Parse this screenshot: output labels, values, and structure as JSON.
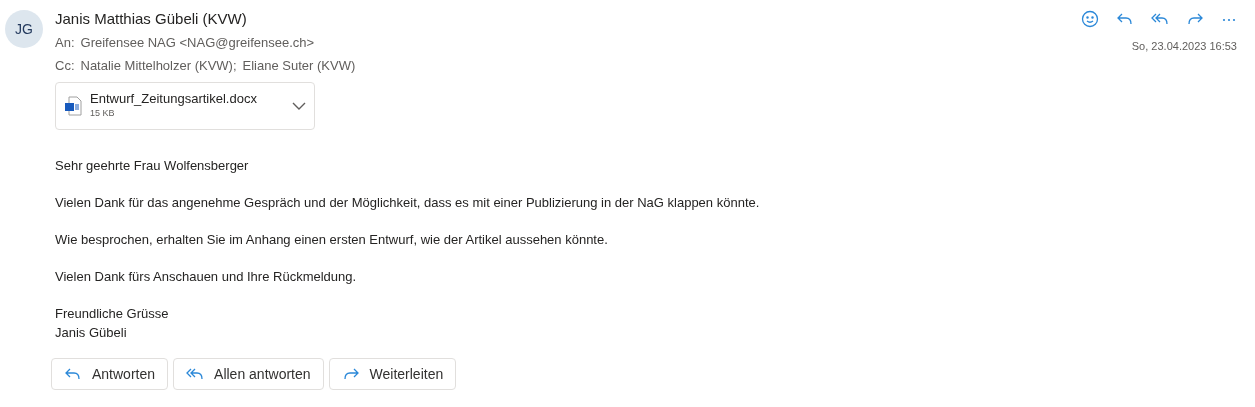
{
  "sender": {
    "initials": "JG",
    "name": "Janis Matthias Gübeli (KVW)"
  },
  "to": {
    "label": "An:",
    "value": "Greifensee NAG <NAG@greifensee.ch>"
  },
  "cc": {
    "label": "Cc:",
    "recipients": [
      "Natalie Mittelholzer (KVW);",
      "Eliane Suter (KVW)"
    ]
  },
  "date": "So, 23.04.2023 16:53",
  "attachment": {
    "name": "Entwurf_Zeitungsartikel.docx",
    "size": "15 KB"
  },
  "body": [
    [
      "Sehr geehrte Frau Wolfensberger"
    ],
    [
      "Vielen Dank für das angenehme Gespräch und der Möglichkeit, dass es mit einer Publizierung in der NaG klappen könnte."
    ],
    [
      "Wie besprochen, erhalten Sie im Anhang einen ersten Entwurf, wie der Artikel aussehen könnte."
    ],
    [
      "Vielen Dank fürs Anschauen und Ihre Rückmeldung."
    ],
    [
      "Freundliche Grüsse",
      "Janis Gübeli"
    ]
  ],
  "buttons": [
    {
      "kind": "reply",
      "label": "Antworten"
    },
    {
      "kind": "reply-all",
      "label": "Allen antworten"
    },
    {
      "kind": "forward",
      "label": "Weiterleiten"
    }
  ]
}
